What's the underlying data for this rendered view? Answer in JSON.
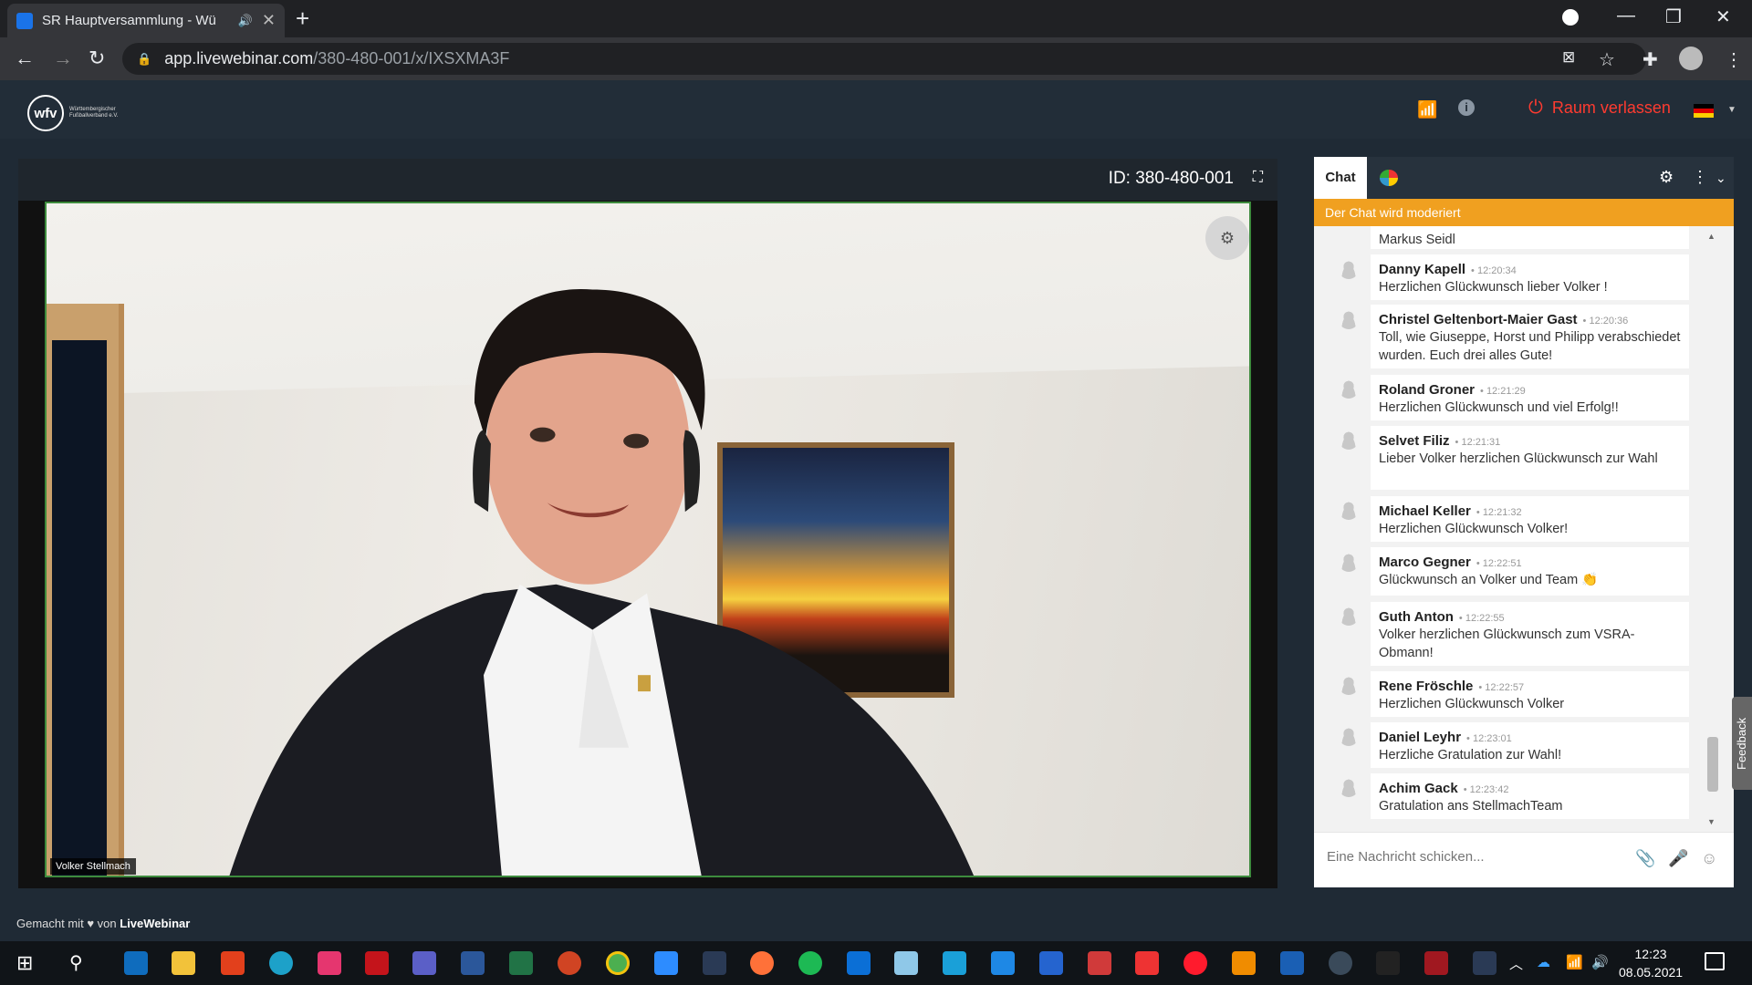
{
  "browser": {
    "tab_title": "SR Hauptversammlung - Wü",
    "tab_audio_icon": "speaker-icon",
    "url_host": "app.livewebinar.com",
    "url_path": "/380-480-001/x/IXSXMA3F"
  },
  "header": {
    "logo_text": "wfv",
    "logo_subtext": "Württembergischer Fußballverband e.V.",
    "leave_label": "Raum verlassen",
    "language": "de"
  },
  "video": {
    "room_id": "ID: 380-480-001",
    "participant_name": "Volker Stellmach"
  },
  "chat": {
    "tab_label": "Chat",
    "moderation_notice": "Der Chat wird moderiert",
    "compose_placeholder": "Eine Nachricht schicken...",
    "messages": [
      {
        "author": "",
        "time": "",
        "text": "Markus Seidl"
      },
      {
        "author": "Danny Kapell",
        "time": "12:20:34",
        "text": "Herzlichen Glückwunsch lieber Volker !"
      },
      {
        "author": "Christel Geltenbort-Maier Gast",
        "time": "12:20:36",
        "text": "Toll, wie Giuseppe, Horst und Philipp verabschiedet wurden. Euch drei alles Gute!"
      },
      {
        "author": "Roland Groner",
        "time": "12:21:29",
        "text": "Herzlichen Glückwunsch und viel Erfolg!!"
      },
      {
        "author": "Selvet Filiz",
        "time": "12:21:31",
        "text": "Lieber Volker herzlichen Glückwunsch zur Wahl"
      },
      {
        "author": "Michael Keller",
        "time": "12:21:32",
        "text": "Herzlichen Glückwunsch Volker!"
      },
      {
        "author": "Marco Gegner",
        "time": "12:22:51",
        "text": "Glückwunsch an Volker und Team 👏"
      },
      {
        "author": "Guth Anton",
        "time": "12:22:55",
        "text": "Volker herzlichen Glückwunsch zum VSRA-Obmann!"
      },
      {
        "author": "Rene Fröschle",
        "time": "12:22:57",
        "text": "Herzlichen Glückwunsch Volker"
      },
      {
        "author": "Daniel Leyhr",
        "time": "12:23:01",
        "text": "Herzliche Gratulation zur Wahl!"
      },
      {
        "author": "Achim Gack",
        "time": "12:23:42",
        "text": "Gratulation ans StellmachTeam"
      }
    ],
    "feedback_label": "Feedback"
  },
  "footer": {
    "prefix": "Gemacht mit",
    "heart": "♥",
    "mid": "von",
    "brand": "LiveWebinar"
  },
  "taskbar": {
    "time": "12:23",
    "date": "08.05.2021"
  },
  "colors": {
    "accent_orange": "#f0a020",
    "leave_red": "#ff3b30",
    "app_bg": "#1f2a35"
  }
}
